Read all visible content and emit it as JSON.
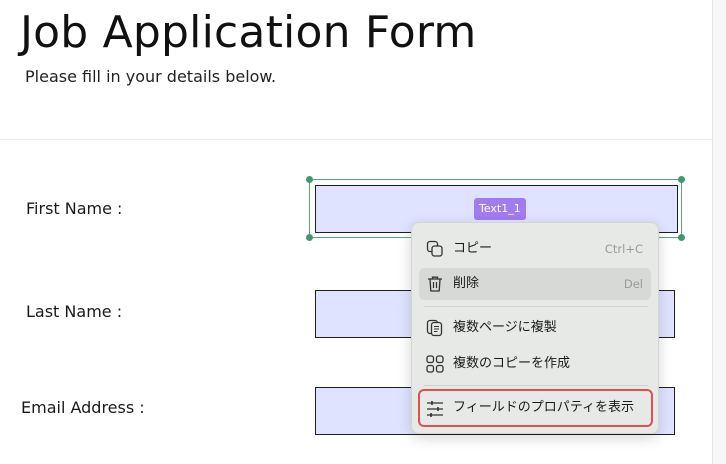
{
  "form": {
    "title": "Job Application Form",
    "subtitle": "Please fill in your details below.",
    "fields": [
      {
        "label": "First Name :"
      },
      {
        "label": "Last Name :"
      },
      {
        "label": "Email Address :"
      }
    ]
  },
  "selected_field": {
    "tag": "Text1_1"
  },
  "context_menu": {
    "items": [
      {
        "label": "コピー",
        "shortcut": "Ctrl+C",
        "icon": "copy-icon"
      },
      {
        "label": "削除",
        "shortcut": "Del",
        "icon": "trash-icon"
      },
      {
        "label": "複数ページに複製",
        "icon": "duplicate-pages-icon"
      },
      {
        "label": "複数のコピーを作成",
        "icon": "multiple-copies-icon"
      },
      {
        "label": "フィールドのプロパティを表示",
        "icon": "sliders-icon"
      }
    ]
  },
  "colors": {
    "field_fill": "#dfe3ff",
    "selection": "#59a47a",
    "tag": "#a07cf0",
    "highlight_outline": "#e05050"
  }
}
